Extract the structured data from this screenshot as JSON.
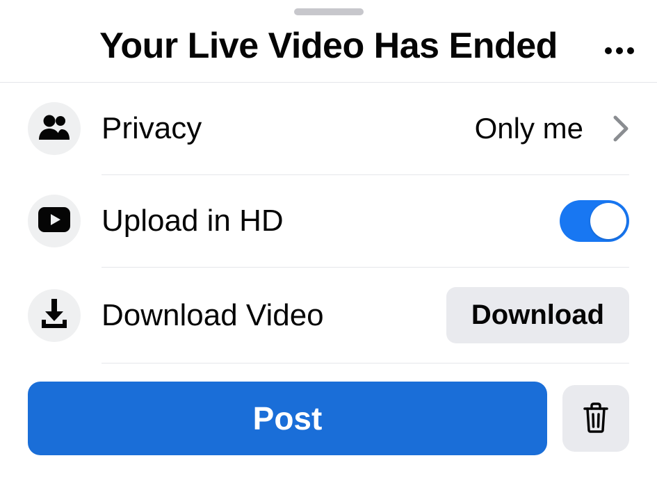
{
  "header": {
    "title": "Your Live Video Has Ended"
  },
  "rows": {
    "privacy": {
      "label": "Privacy",
      "value": "Only me"
    },
    "hd": {
      "label": "Upload in HD",
      "on": true
    },
    "download": {
      "label": "Download Video",
      "button": "Download"
    }
  },
  "footer": {
    "post": "Post"
  },
  "colors": {
    "accent": "#1877f2",
    "button_primary": "#1a6ed8",
    "surface_secondary": "#e9eaee"
  }
}
